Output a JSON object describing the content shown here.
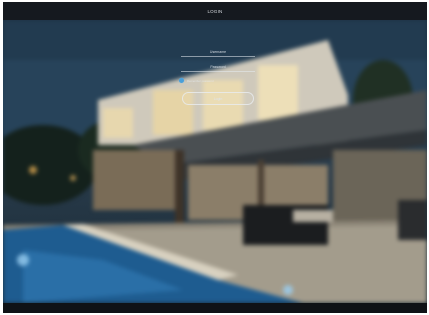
{
  "header": {
    "title": "LOGIN"
  },
  "login_form": {
    "username_placeholder": "Username",
    "password_placeholder": "Password",
    "remember_label": "Remember password",
    "login_button_label": "Login"
  },
  "colors": {
    "accent": "#4a9fd8",
    "background": "#0f1216"
  }
}
